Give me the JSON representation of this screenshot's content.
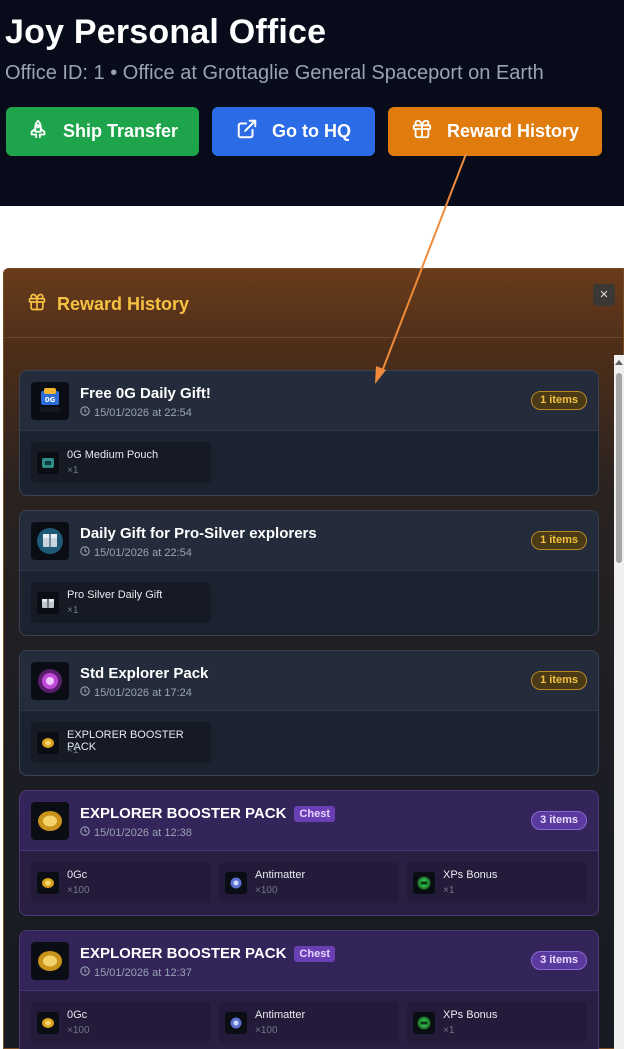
{
  "header": {
    "title": "Joy Personal Office",
    "subtitle": "Office ID: 1 • Office at Grottaglie General Spaceport on Earth",
    "buttons": {
      "ship_transfer": "Ship Transfer",
      "go_to_hq": "Go to HQ",
      "reward_history": "Reward History"
    }
  },
  "modal": {
    "title": "Reward History",
    "close_label": "×",
    "rewards": [
      {
        "title": "Free 0G Daily Gift!",
        "timestamp": "15/01/2026 at 22:54",
        "count": "1 items",
        "items": [
          {
            "name": "0G Medium Pouch",
            "qty": "×1"
          }
        ]
      },
      {
        "title": "Daily Gift for Pro-Silver explorers",
        "timestamp": "15/01/2026 at 22:54",
        "count": "1 items",
        "items": [
          {
            "name": "Pro Silver Daily Gift",
            "qty": "×1"
          }
        ]
      },
      {
        "title": "Std Explorer Pack",
        "timestamp": "15/01/2026 at 17:24",
        "count": "1 items",
        "items": [
          {
            "name": "EXPLORER BOOSTER PACK",
            "qty": "×1"
          }
        ]
      },
      {
        "title": "EXPLORER BOOSTER PACK",
        "tag": "Chest",
        "timestamp": "15/01/2026 at 12:38",
        "count": "3 items",
        "items": [
          {
            "name": "0Gc",
            "qty": "×100"
          },
          {
            "name": "Antimatter",
            "qty": "×100"
          },
          {
            "name": "XPs Bonus",
            "qty": "×1"
          }
        ]
      },
      {
        "title": "EXPLORER BOOSTER PACK",
        "tag": "Chest",
        "timestamp": "15/01/2026 at 12:37",
        "count": "3 items",
        "items": [
          {
            "name": "0Gc",
            "qty": "×100"
          },
          {
            "name": "Antimatter",
            "qty": "×100"
          },
          {
            "name": "XPs Bonus",
            "qty": "×1"
          }
        ]
      }
    ]
  },
  "colors": {
    "ship_transfer": "#1ea54b",
    "go_to_hq": "#2b6be6",
    "reward_history": "#e07c0e",
    "modal_title": "#f7c143",
    "annotation_arrow": "#ee8a3a"
  },
  "icons": {
    "ship_transfer": "ship-icon",
    "go_to_hq": "external-link-icon",
    "reward_history": "gift-icon",
    "timestamp": "clock-icon"
  }
}
